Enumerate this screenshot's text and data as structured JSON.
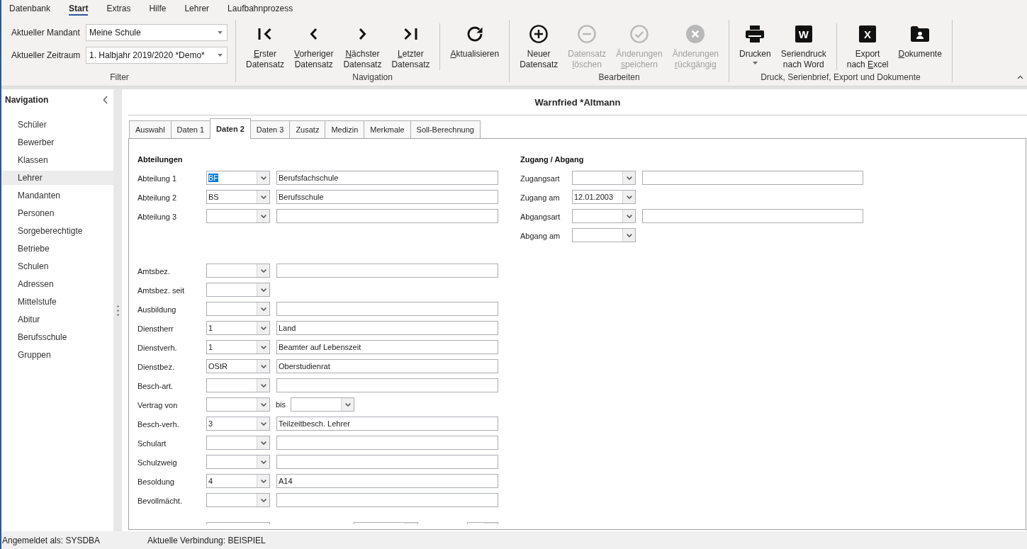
{
  "menu_tabs": [
    {
      "label": "Datenbank",
      "selected": false
    },
    {
      "label": "Start",
      "selected": true
    },
    {
      "label": "Extras",
      "selected": false
    },
    {
      "label": "Hilfe",
      "selected": false
    },
    {
      "label": "Lehrer",
      "selected": false
    },
    {
      "label": "Laufbahnprozess",
      "selected": false
    }
  ],
  "ribbon": {
    "groups": [
      {
        "kind": "filter",
        "label": "Filter",
        "fields": [
          {
            "label": "Aktueller Mandant",
            "value": "Meine Schule"
          },
          {
            "label": "Aktueller Zeitraum",
            "value": "1. Halbjahr 2019/2020 *Demo*"
          }
        ]
      },
      {
        "kind": "buttons",
        "label": "Navigation",
        "clusters": [
          [
            {
              "kind": "first",
              "disabled": false,
              "dropdown": false,
              "lines": [
                {
                  "key": "E",
                  "post": "rster"
                },
                "Datensatz"
              ]
            },
            {
              "kind": "previous",
              "disabled": false,
              "dropdown": false,
              "lines": [
                {
                  "key": "V",
                  "post": "orheriger"
                },
                "Datensatz"
              ]
            },
            {
              "kind": "next",
              "disabled": false,
              "dropdown": false,
              "lines": [
                {
                  "key": "N",
                  "post": "ächster"
                },
                "Datensatz"
              ]
            },
            {
              "kind": "last",
              "disabled": false,
              "dropdown": false,
              "lines": [
                {
                  "key": "L",
                  "post": "etzter"
                },
                "Datensatz"
              ]
            }
          ],
          [
            {
              "kind": "refresh",
              "disabled": false,
              "dropdown": false,
              "lines": [
                {
                  "key": "A",
                  "post": "ktualisieren"
                }
              ]
            }
          ]
        ]
      },
      {
        "kind": "buttons",
        "label": "Bearbeiten",
        "clusters": [
          [
            {
              "kind": "add",
              "disabled": false,
              "dropdown": false,
              "lines": [
                "Neuer",
                "Datensatz"
              ]
            },
            {
              "kind": "remove",
              "disabled": true,
              "dropdown": false,
              "lines": [
                "Datensatz",
                {
                  "key": "l",
                  "post": "öschen"
                }
              ]
            },
            {
              "kind": "save",
              "disabled": true,
              "dropdown": false,
              "lines": [
                "Änderungen",
                {
                  "key": "s",
                  "post": "peichern"
                }
              ]
            },
            {
              "kind": "undo",
              "disabled": true,
              "dropdown": false,
              "lines": [
                "Änderungen",
                {
                  "key": "r",
                  "post": "ückgängig"
                }
              ]
            }
          ]
        ]
      },
      {
        "kind": "buttons",
        "label": "Druck, Serienbrief, Export und Dokumente",
        "clusters": [
          [
            {
              "kind": "print",
              "disabled": false,
              "dropdown": true,
              "lines": [
                "Drucken"
              ]
            },
            {
              "kind": "tile",
              "tile": "W",
              "disabled": false,
              "dropdown": false,
              "lines": [
                "Seriendruck",
                "nach Word"
              ]
            }
          ],
          [
            {
              "kind": "tile",
              "tile": "X",
              "disabled": false,
              "dropdown": false,
              "lines": [
                "Export",
                {
                  "pre": "nach ",
                  "key": "E",
                  "post": "xcel"
                }
              ]
            },
            {
              "kind": "documents",
              "disabled": false,
              "dropdown": false,
              "lines": [
                {
                  "key": "D",
                  "post": "okumente"
                }
              ]
            }
          ]
        ]
      }
    ]
  },
  "sidebar": {
    "title": "Navigation",
    "items": [
      {
        "label": "Schüler",
        "selected": false
      },
      {
        "label": "Bewerber",
        "selected": false
      },
      {
        "label": "Klassen",
        "selected": false
      },
      {
        "label": "Lehrer",
        "selected": true
      },
      {
        "label": "Mandanten",
        "selected": false
      },
      {
        "label": "Personen",
        "selected": false
      },
      {
        "label": "Sorgeberechtigte",
        "selected": false
      },
      {
        "label": "Betriebe",
        "selected": false
      },
      {
        "label": "Schulen",
        "selected": false
      },
      {
        "label": "Adressen",
        "selected": false
      },
      {
        "label": "Mittelstufe",
        "selected": false
      },
      {
        "label": "Abitur",
        "selected": false
      },
      {
        "label": "Berufsschule",
        "selected": false
      },
      {
        "label": "Gruppen",
        "selected": false
      }
    ]
  },
  "record": {
    "title": "Warnfried *Altmann"
  },
  "tabs": [
    {
      "label": "Auswahl",
      "selected": false
    },
    {
      "label": "Daten 1",
      "selected": false
    },
    {
      "label": "Daten 2",
      "selected": true
    },
    {
      "label": "Daten 3",
      "selected": false
    },
    {
      "label": "Zusatz",
      "selected": false
    },
    {
      "label": "Medizin",
      "selected": false
    },
    {
      "label": "Merkmale",
      "selected": false
    },
    {
      "label": "Soll-Berechnung",
      "selected": false
    }
  ],
  "form": {
    "columns": [
      {
        "title": "Abteilungen",
        "row_groups": [
          [
            {
              "kind": "combo_text",
              "label": "Abteilung 1",
              "code": "BF",
              "highlighted": true,
              "text": "Berufsfachschule"
            },
            {
              "kind": "combo_text",
              "label": "Abteilung 2",
              "code": "BS",
              "highlighted": false,
              "text": "Berufsschule"
            },
            {
              "kind": "combo_text",
              "label": "Abteilung 3"
            }
          ],
          [
            {
              "kind": "combo_text",
              "label": "Amtsbez."
            },
            {
              "kind": "combo",
              "label": "Amtsbez. seit"
            },
            {
              "kind": "combo_text",
              "label": "Ausbildung"
            },
            {
              "kind": "combo_text",
              "label": "Dienstherr",
              "code": "1",
              "highlighted": false,
              "text": "Land"
            },
            {
              "kind": "combo_text",
              "label": "Dienstverh.",
              "code": "1",
              "highlighted": false,
              "text": "Beamter auf Lebenszeit"
            },
            {
              "kind": "combo_text",
              "label": "Dienstbez.",
              "code": "OStR",
              "highlighted": false,
              "text": "Oberstudienrat"
            },
            {
              "kind": "combo_text",
              "label": "Besch-art."
            },
            {
              "kind": "range",
              "label": "Vertrag von",
              "joiner": "bis"
            },
            {
              "kind": "combo_text",
              "label": "Besch-verh.",
              "code": "3",
              "highlighted": false,
              "text": "Teilzeitbesch. Lehrer"
            },
            {
              "kind": "combo_text",
              "label": "Schulart"
            },
            {
              "kind": "combo_text",
              "label": "Schulzweig"
            },
            {
              "kind": "combo_text",
              "label": "Besoldung",
              "code": "4",
              "highlighted": false,
              "text": "A14"
            },
            {
              "kind": "combo_text",
              "label": "Bevollmächt."
            },
            {
              "kind": "cut_off"
            }
          ]
        ]
      },
      {
        "title": "Zugang / Abgang",
        "row_groups": [
          [
            {
              "kind": "combo_text",
              "label": "Zugangsart"
            },
            {
              "kind": "combo",
              "label": "Zugang am",
              "code": "12.01.2003",
              "highlighted": false
            },
            {
              "kind": "combo_text",
              "label": "Abgangsart"
            },
            {
              "kind": "combo",
              "label": "Abgang am"
            }
          ]
        ]
      }
    ]
  },
  "status_bar": {
    "user": "Angemeldet als: SYSDBA",
    "connection": "Aktuelle Verbindung: BEISPIEL"
  }
}
